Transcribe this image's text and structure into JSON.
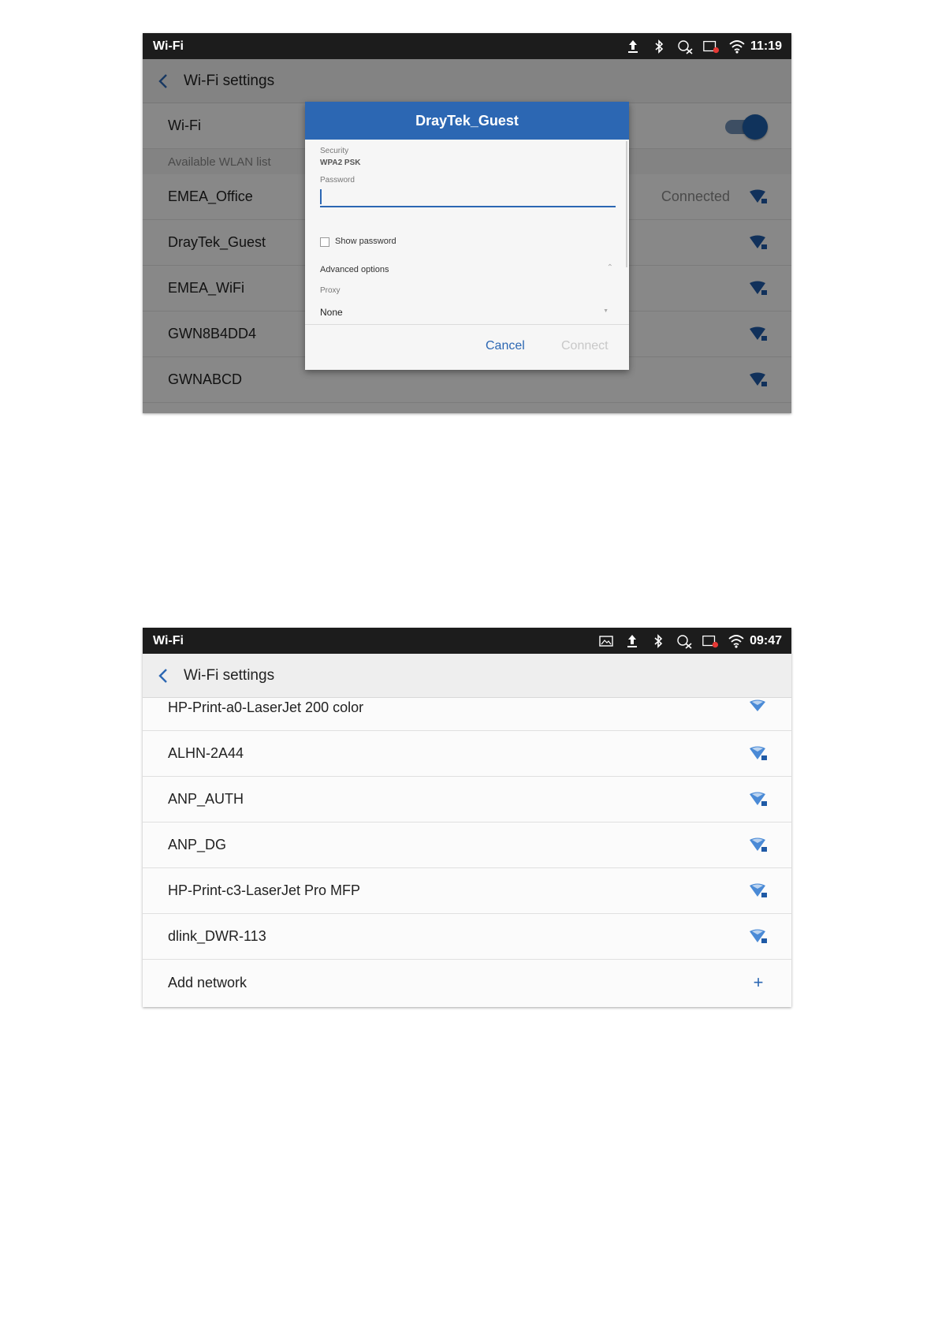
{
  "screen1": {
    "statusbar": {
      "title": "Wi-Fi",
      "time": "11:19"
    },
    "topbar": {
      "title": "Wi-Fi settings"
    },
    "wifi_row": {
      "label": "Wi-Fi"
    },
    "section": {
      "label": "Available WLAN list"
    },
    "networks": [
      {
        "name": "EMEA_Office",
        "status": "Connected"
      },
      {
        "name": "DrayTek_Guest",
        "status": ""
      },
      {
        "name": "EMEA_WiFi",
        "status": ""
      },
      {
        "name": "GWN8B4DD4",
        "status": ""
      },
      {
        "name": "GWNABCD",
        "status": ""
      }
    ],
    "dialog": {
      "title": "DrayTek_Guest",
      "security_label": "Security",
      "security_value": "WPA2 PSK",
      "password_label": "Password",
      "password_value": "",
      "show_password_label": "Show password",
      "advanced_options_label": "Advanced options",
      "proxy_label": "Proxy",
      "proxy_value": "None",
      "cancel_label": "Cancel",
      "connect_label": "Connect"
    },
    "colors": {
      "accent": "#2c67b3",
      "wifi_icon": "#1f5aa6"
    }
  },
  "screen2": {
    "statusbar": {
      "title": "Wi-Fi",
      "time": "09:47"
    },
    "topbar": {
      "title": "Wi-Fi settings"
    },
    "networks": [
      {
        "name": "HP-Print-a0-LaserJet 200 color"
      },
      {
        "name": "ALHN-2A44"
      },
      {
        "name": "ANP_AUTH"
      },
      {
        "name": "ANP_DG"
      },
      {
        "name": "HP-Print-c3-LaserJet Pro MFP"
      },
      {
        "name": "dlink_DWR-113"
      }
    ],
    "add_network": {
      "label": "Add network",
      "icon": "plus-icon"
    },
    "colors": {
      "accent": "#2c67b3",
      "wifi_icon": "#4a8ad6"
    }
  }
}
